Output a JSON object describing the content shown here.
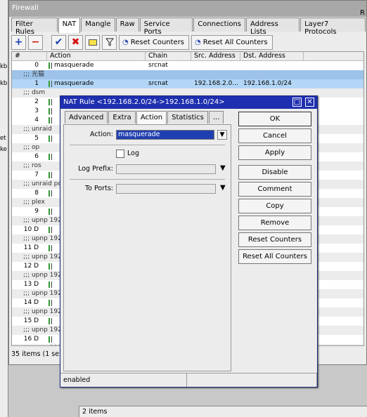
{
  "left_strip": [
    "kb",
    "kb",
    "et",
    "ke"
  ],
  "firewall_window": {
    "title": "Firewall",
    "corner_letter": "R",
    "tabs": [
      "Filter Rules",
      "NAT",
      "Mangle",
      "Raw",
      "Service Ports",
      "Connections",
      "Address Lists",
      "Layer7 Protocols"
    ],
    "toolbar": {
      "add_icon": "plus-icon",
      "remove_icon": "minus-icon",
      "enable_icon": "check-icon",
      "disable_icon": "x-icon",
      "comment_icon": "note-icon",
      "filter_icon": "funnel-icon",
      "reset_counters": "Reset Counters",
      "reset_all_counters": "Reset All Counters"
    },
    "columns": [
      "#",
      "Action",
      "Chain",
      "Src. Address",
      "Dst. Address"
    ],
    "rows": [
      {
        "type": "rule",
        "num": "0",
        "action": "masquerade",
        "chain": "srcnat",
        "src": "",
        "dst": ""
      },
      {
        "type": "comment",
        "text": ";;; 光猫",
        "selected": true
      },
      {
        "type": "rule",
        "num": "1",
        "action": "masquerade",
        "chain": "srcnat",
        "src": "192.168.2.0...",
        "dst": "192.168.1.0/24",
        "selected": true
      },
      {
        "type": "comment",
        "text": ";;; dsm"
      },
      {
        "type": "rule",
        "num": "2"
      },
      {
        "type": "rule",
        "num": "3"
      },
      {
        "type": "rule",
        "num": "4"
      },
      {
        "type": "comment",
        "text": ";;; unraid"
      },
      {
        "type": "rule",
        "num": "5"
      },
      {
        "type": "comment",
        "text": ";;; op"
      },
      {
        "type": "rule",
        "num": "6"
      },
      {
        "type": "comment",
        "text": ";;; ros"
      },
      {
        "type": "rule",
        "num": "7"
      },
      {
        "type": "comment",
        "text": ";;; unraid pc"
      },
      {
        "type": "rule",
        "num": "8"
      },
      {
        "type": "comment",
        "text": ";;; plex"
      },
      {
        "type": "rule",
        "num": "9"
      },
      {
        "type": "comment",
        "text": ";;; upnp 192.1"
      },
      {
        "type": "rule",
        "num": "10 D"
      },
      {
        "type": "comment",
        "text": ";;; upnp 192.1"
      },
      {
        "type": "rule",
        "num": "11 D"
      },
      {
        "type": "comment",
        "text": ";;; upnp 192.1"
      },
      {
        "type": "rule",
        "num": "12 D"
      },
      {
        "type": "comment",
        "text": ";;; upnp 192.1"
      },
      {
        "type": "rule",
        "num": "13 D"
      },
      {
        "type": "comment",
        "text": ";;; upnp 192.1"
      },
      {
        "type": "rule",
        "num": "14 D"
      },
      {
        "type": "comment",
        "text": ";;; upnp 192.1"
      },
      {
        "type": "rule",
        "num": "15 D"
      },
      {
        "type": "comment",
        "text": ";;; upnp 192.1"
      },
      {
        "type": "rule",
        "num": "16 D"
      },
      {
        "type": "comment",
        "text": ";;; upnp 192.1"
      }
    ],
    "status": "35 items (1 se"
  },
  "bottom_status": "2 items",
  "dialog": {
    "title": "NAT Rule <192.168.2.0/24->192.168.1.0/24>",
    "tabs": [
      "Advanced",
      "Extra",
      "Action",
      "Statistics",
      "..."
    ],
    "action_label": "Action:",
    "action_value": "masquerade",
    "log_label": "Log",
    "log_prefix_label": "Log Prefix:",
    "to_ports_label": "To Ports:",
    "buttons": [
      "OK",
      "Cancel",
      "Apply",
      "Disable",
      "Comment",
      "Copy",
      "Remove",
      "Reset Counters",
      "Reset All Counters"
    ],
    "status": "enabled"
  }
}
